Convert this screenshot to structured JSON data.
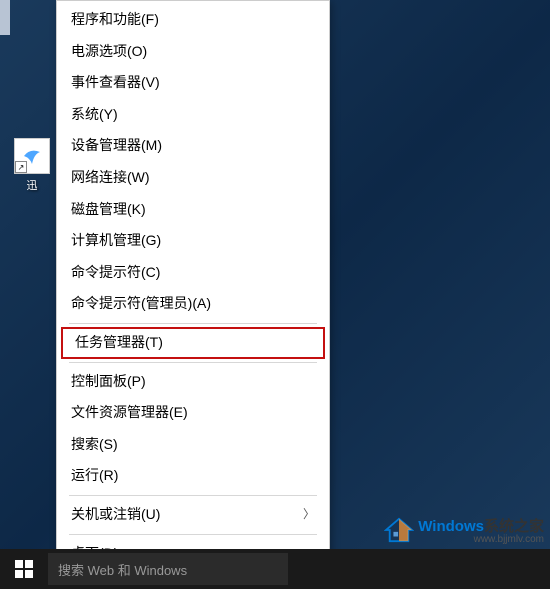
{
  "desktop": {
    "icon_label": "迅"
  },
  "menu": {
    "items": [
      {
        "label": "程序和功能(F)",
        "type": "item"
      },
      {
        "label": "电源选项(O)",
        "type": "item"
      },
      {
        "label": "事件查看器(V)",
        "type": "item"
      },
      {
        "label": "系统(Y)",
        "type": "item"
      },
      {
        "label": "设备管理器(M)",
        "type": "item"
      },
      {
        "label": "网络连接(W)",
        "type": "item"
      },
      {
        "label": "磁盘管理(K)",
        "type": "item"
      },
      {
        "label": "计算机管理(G)",
        "type": "item"
      },
      {
        "label": "命令提示符(C)",
        "type": "item"
      },
      {
        "label": "命令提示符(管理员)(A)",
        "type": "item"
      },
      {
        "type": "separator"
      },
      {
        "label": "任务管理器(T)",
        "type": "item",
        "highlighted": true
      },
      {
        "type": "separator"
      },
      {
        "label": "控制面板(P)",
        "type": "item"
      },
      {
        "label": "文件资源管理器(E)",
        "type": "item"
      },
      {
        "label": "搜索(S)",
        "type": "item"
      },
      {
        "label": "运行(R)",
        "type": "item"
      },
      {
        "type": "separator"
      },
      {
        "label": "关机或注销(U)",
        "type": "item",
        "submenu": true
      },
      {
        "type": "separator"
      },
      {
        "label": "桌面(D)",
        "type": "item"
      }
    ],
    "submenu_arrow": "〉"
  },
  "taskbar": {
    "search_placeholder": "搜索 Web 和 Windows"
  },
  "watermark": {
    "brand": "Windows",
    "suffix": "系统之家",
    "url": "www.bjjmlv.com"
  }
}
